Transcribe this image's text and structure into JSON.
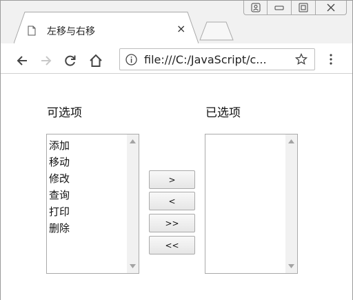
{
  "browser": {
    "tab_title": "左移与右移",
    "tab_close": "×",
    "url": "file:///C:/JavaScript/c..."
  },
  "page": {
    "available_label": "可选项",
    "selected_label": "已选项",
    "available_items": [
      "添加",
      "移动",
      "修改",
      "查询",
      "打印",
      "删除"
    ],
    "selected_items": [],
    "buttons": {
      "move_right": ">",
      "move_left": "<",
      "move_all_right": ">>",
      "move_all_left": "<<"
    }
  },
  "colors": {
    "chrome_bg": "#f1f1f1",
    "border": "#a9a9a9"
  }
}
